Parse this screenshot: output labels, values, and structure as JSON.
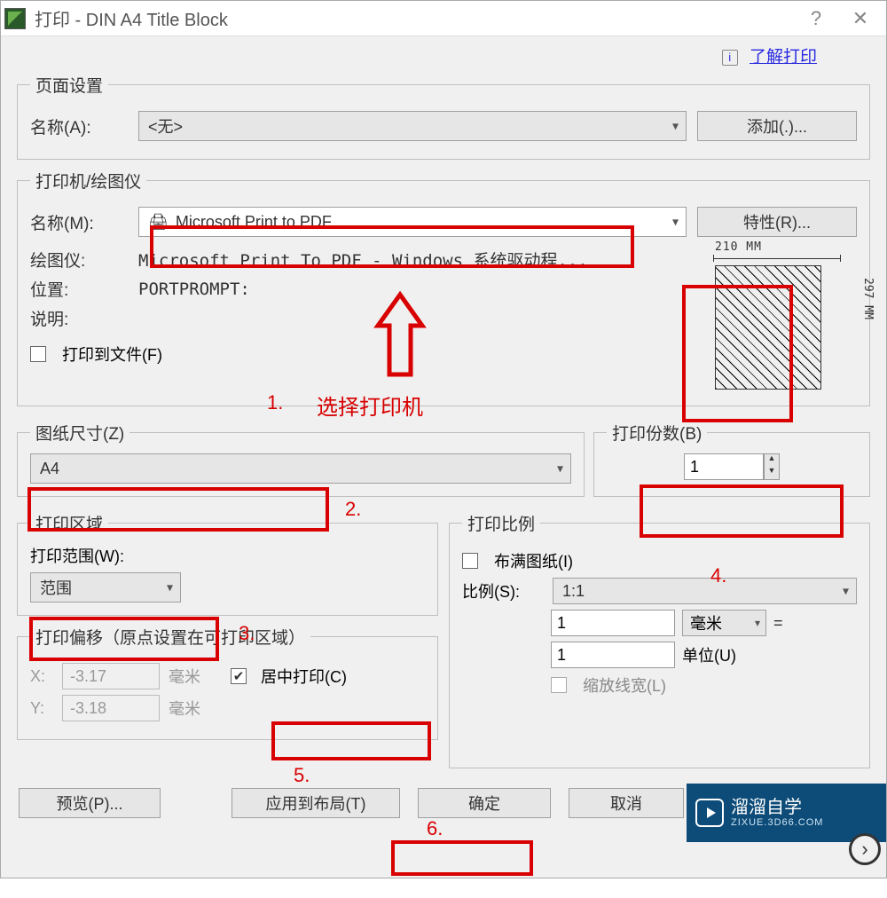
{
  "titlebar": {
    "title": "打印 - DIN A4 Title Block"
  },
  "toplink": {
    "label": "了解打印"
  },
  "page_setup": {
    "legend": "页面设置",
    "name_label": "名称(A):",
    "name_value": "<无>",
    "add_btn": "添加(.)..."
  },
  "printer": {
    "legend": "打印机/绘图仪",
    "name_label": "名称(M):",
    "name_value": "Microsoft Print to PDF",
    "properties_btn": "特性(R)...",
    "plotter_label": "绘图仪:",
    "plotter_value": "Microsoft Print To PDF - Windows 系统驱动程...",
    "location_label": "位置:",
    "location_value": "PORTPROMPT:",
    "desc_label": "说明:",
    "print_to_file": "打印到文件(F)",
    "paper_top": "210 MM",
    "paper_right": "297 MM"
  },
  "paper_size": {
    "legend": "图纸尺寸(Z)",
    "value": "A4"
  },
  "copies": {
    "legend": "打印份数(B)",
    "value": "1"
  },
  "area": {
    "legend": "打印区域",
    "range_label": "打印范围(W):",
    "range_value": "范围"
  },
  "offset": {
    "legend": "打印偏移（原点设置在可打印区域）",
    "x_label": "X:",
    "x_value": "-3.17",
    "x_unit": "毫米",
    "y_label": "Y:",
    "y_value": "-3.18",
    "y_unit": "毫米",
    "center": "居中打印(C)"
  },
  "scale": {
    "legend": "打印比例",
    "fit": "布满图纸(I)",
    "ratio_label": "比例(S):",
    "ratio_value": "1:1",
    "num1": "1",
    "unit1": "毫米",
    "num2": "1",
    "unit2_label": "单位(U)",
    "scale_lw": "缩放线宽(L)"
  },
  "buttons": {
    "preview": "预览(P)...",
    "apply": "应用到布局(T)",
    "ok": "确定",
    "cancel": "取消"
  },
  "annotations": {
    "a1": "1.",
    "a1_text": "选择打印机",
    "a2": "2.",
    "a3": "3.",
    "a4": "4.",
    "a5": "5.",
    "a6": "6."
  },
  "watermark": {
    "line1": "溜溜自学",
    "line2": "ZIXUE.3D66.COM"
  }
}
